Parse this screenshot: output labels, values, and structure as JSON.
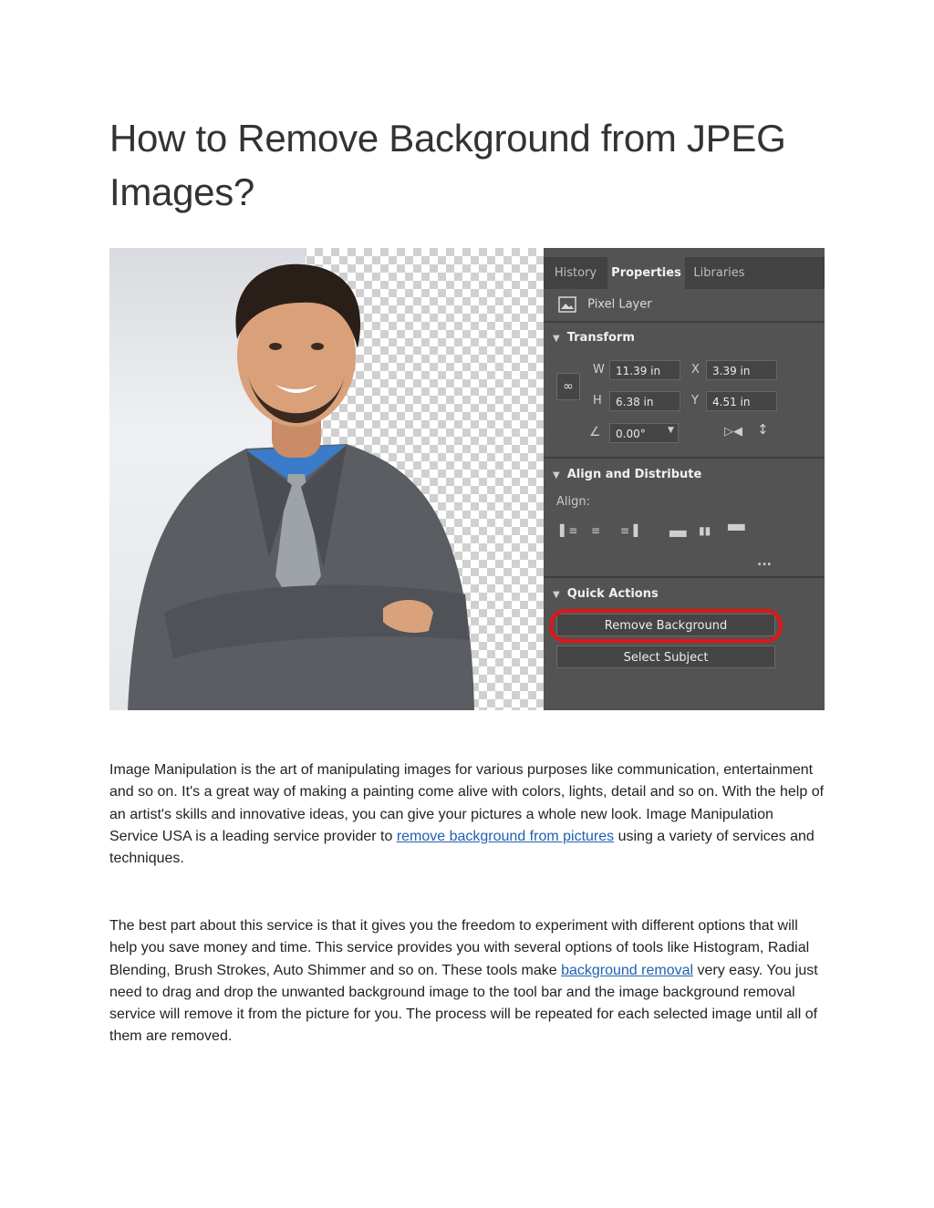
{
  "document": {
    "title": "How to Remove Background from JPEG Images?",
    "paragraph1": {
      "text_before": "Image Manipulation is the art of manipulating images for various purposes like communication, entertainment and so on. It's a great way of making a painting come alive with colors, lights, detail and so on. With the help of an artist's skills and innovative ideas, you can give your pictures a whole new look. Image Manipulation Service USA is a leading service provider to ",
      "link": "remove background from pictures",
      "text_after": " using a variety of services and techniques."
    },
    "paragraph2": {
      "text_before": "The best part about this service is that it gives you the freedom to experiment with different options that will help you save money and time. This service provides you with several options of tools like Histogram, Radial Blending, Brush Strokes, Auto Shimmer and so on. These tools make ",
      "link": "background removal",
      "text_after": " very easy. You just need to drag and drop the unwanted background image to the tool bar and the image background removal service will remove it from the picture for you. The process will be repeated for each selected image until all of them are removed."
    }
  },
  "panel": {
    "tabs": [
      "History",
      "Properties",
      "Libraries"
    ],
    "active_tab": "Properties",
    "layer_label": "Pixel Layer",
    "transform": {
      "heading": "Transform",
      "w_label": "W",
      "w_value": "11.39 in",
      "x_label": "X",
      "x_value": "3.39 in",
      "h_label": "H",
      "h_value": "6.38 in",
      "y_label": "Y",
      "y_value": "4.51 in",
      "angle_value": "0.00°"
    },
    "align": {
      "heading": "Align and Distribute",
      "label": "Align:",
      "more": "..."
    },
    "quick_actions": {
      "heading": "Quick Actions",
      "remove_background": "Remove Background",
      "select_subject": "Select Subject"
    }
  },
  "colors": {
    "panel_bg": "#535353",
    "highlight": "#e01616",
    "link": "#1f5fb0"
  }
}
